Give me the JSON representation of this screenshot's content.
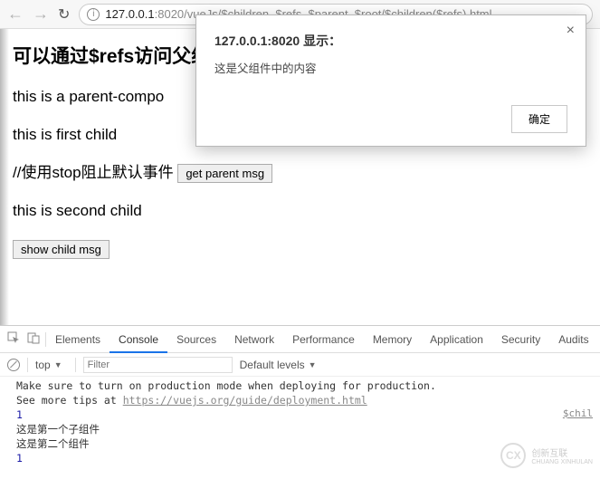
{
  "toolbar": {
    "url_host": "127.0.0.1",
    "url_port": ":8020",
    "url_path": "/vueJs/$children_$refs_$parent_$root/$children($refs).html"
  },
  "page": {
    "heading": "可以通过$refs访问父组",
    "line1": "this is a parent-compo",
    "line2": "this is first child",
    "line3_prefix": "//使用stop阻止默认事件",
    "get_parent_btn": "get parent msg",
    "line4": "this is second child",
    "show_child_btn": "show child msg"
  },
  "dialog": {
    "title": "127.0.0.1:8020 显示：",
    "message": "这是父组件中的内容",
    "ok": "确定"
  },
  "devtools": {
    "tabs": {
      "elements": "Elements",
      "console": "Console",
      "sources": "Sources",
      "network": "Network",
      "performance": "Performance",
      "memory": "Memory",
      "application": "Application",
      "security": "Security",
      "audits": "Audits"
    },
    "filter": {
      "context": "top",
      "placeholder": "Filter",
      "levels": "Default levels"
    },
    "console": {
      "warn1": "Make sure to turn on production mode when deploying for production.",
      "warn2_prefix": "See more tips at ",
      "warn2_link": "https://vuejs.org/guide/deployment.html",
      "n1": "1",
      "l1": "这是第一个子组件",
      "l2": "这是第二个组件",
      "n2": "1",
      "src": "$chil"
    }
  },
  "watermark": {
    "brand": "CX",
    "text1": "创新互联",
    "text2": "CHUANG XINHULAN"
  }
}
